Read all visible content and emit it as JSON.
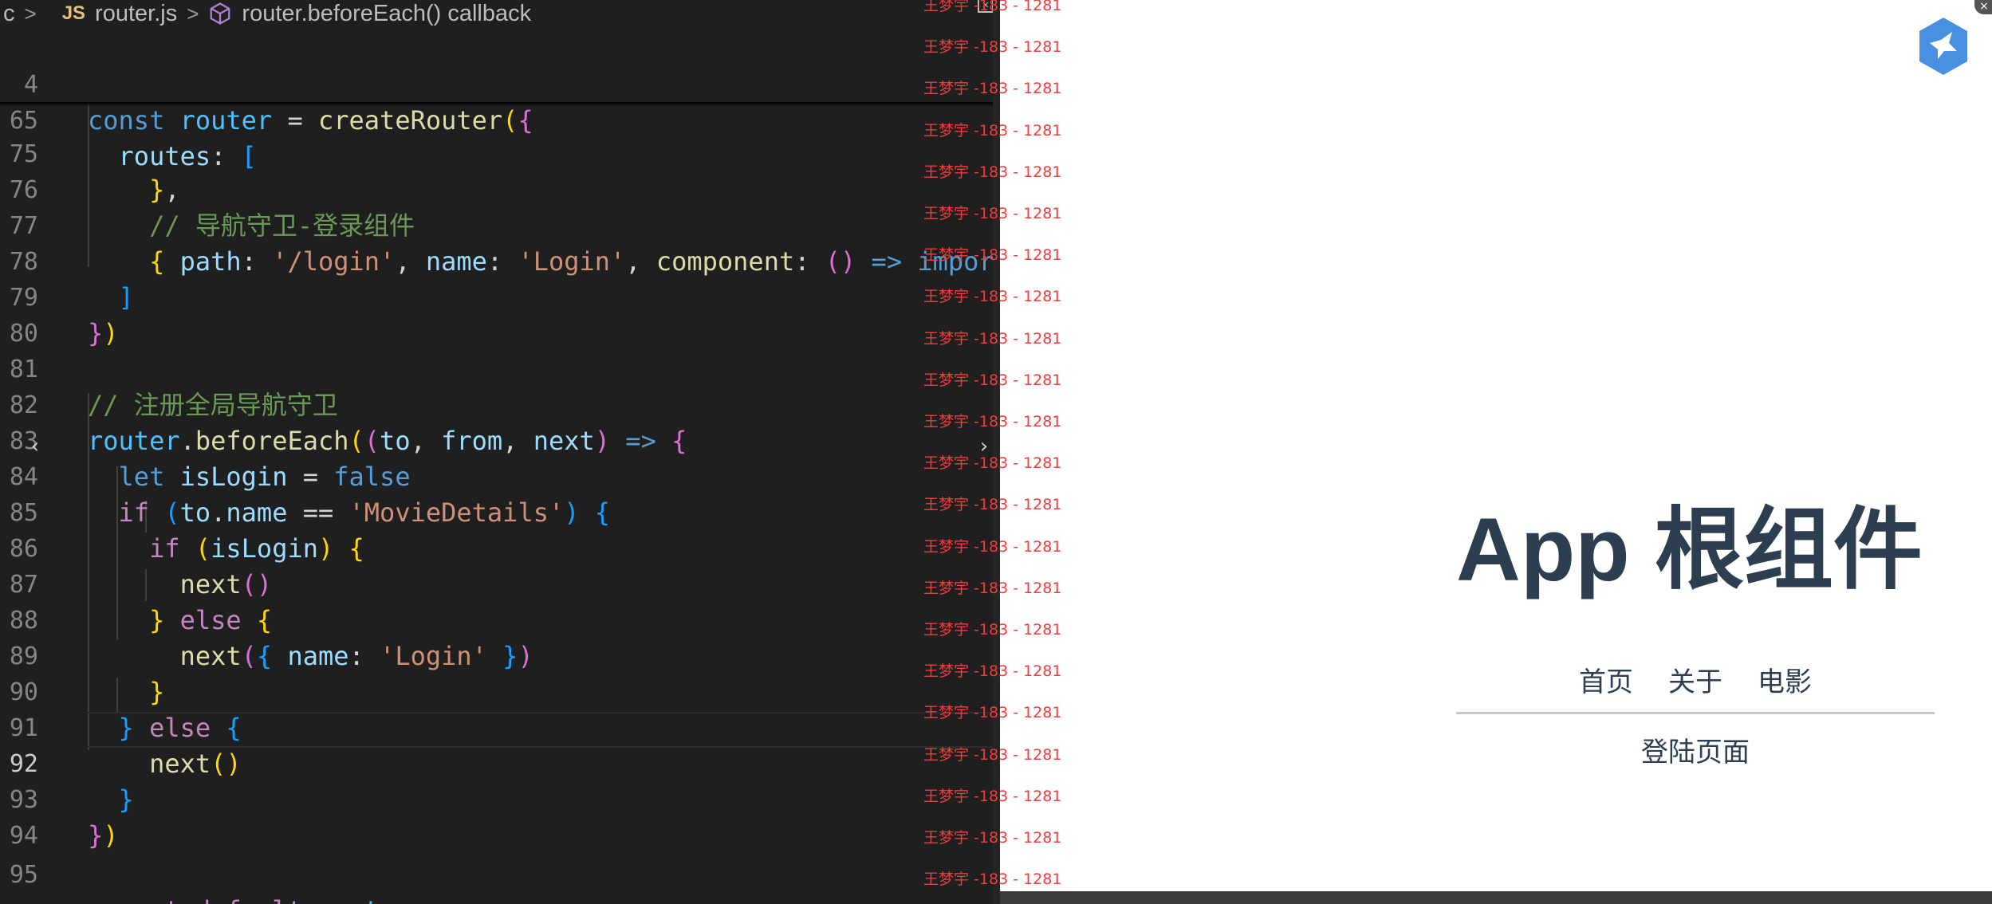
{
  "breadcrumb": {
    "prefix": "c",
    "js_badge": "JS",
    "file": "router.js",
    "symbol": "router.beforeEach() callback"
  },
  "code": {
    "current_line": "92",
    "lines": [
      {
        "n": "4"
      },
      {
        "n": "65"
      },
      {
        "n": "75"
      },
      {
        "n": "76"
      },
      {
        "n": "77"
      },
      {
        "n": "78"
      },
      {
        "n": "79"
      },
      {
        "n": "80"
      },
      {
        "n": "81"
      },
      {
        "n": "82"
      },
      {
        "n": "83"
      },
      {
        "n": "84"
      },
      {
        "n": "85"
      },
      {
        "n": "86"
      },
      {
        "n": "87"
      },
      {
        "n": "88"
      },
      {
        "n": "89"
      },
      {
        "n": "90"
      },
      {
        "n": "91"
      },
      {
        "n": "92"
      },
      {
        "n": "93"
      },
      {
        "n": "94"
      },
      {
        "n": "95"
      }
    ],
    "t": {
      "const": "const",
      "router": "router",
      "createRouter": "createRouter",
      "routes": "routes",
      "comment_login": "// 导航守卫-登录组件",
      "path_key": "path",
      "login_path": "'/login'",
      "name_key": "name",
      "login_name": "'Login'",
      "component_key": "component",
      "import_kw": "import",
      "comment_global": "// 注册全局导航守卫",
      "beforeEach": "beforeEach",
      "to": "to",
      "from": "from",
      "next": "next",
      "let": "let",
      "isLogin": "isLogin",
      "false": "false",
      "if": "if",
      "movie_details": "'MovieDetails'",
      "else": "else",
      "export": "export",
      "default": "default"
    }
  },
  "pane_arrows": {
    "left": "‹",
    "right": "›"
  },
  "watermark": {
    "text": "王梦宇 -183 - 1281"
  },
  "preview": {
    "title": "App 根组件",
    "nav": [
      "首页",
      "关于",
      "电影"
    ],
    "view_text": "登陆页面"
  },
  "colors": {
    "editor_bg": "#1f1f1f",
    "keyword": "#569cd6",
    "control": "#c586c0",
    "function": "#dcdcaa",
    "variable": "#9cdcfe",
    "string": "#ce9178",
    "comment": "#6a9955",
    "title": "#2c3e50",
    "watermark": "#ef3c3c",
    "logo": "#4a90e2"
  },
  "icons": [
    "js-file-icon",
    "symbol-method-icon",
    "bird-logo-icon",
    "close-icon"
  ]
}
